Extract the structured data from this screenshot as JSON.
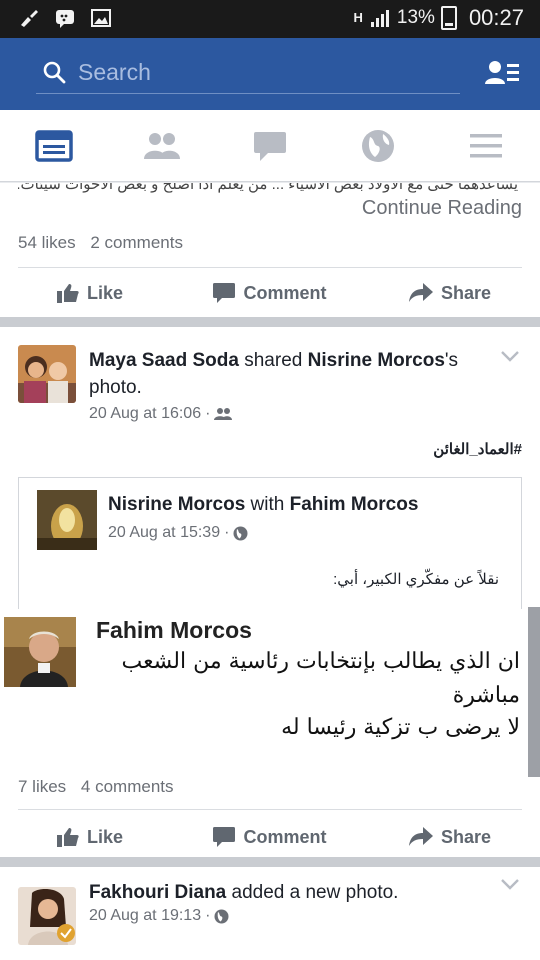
{
  "status_bar": {
    "network": "H",
    "battery": "13%",
    "time": "00:27"
  },
  "search": {
    "placeholder": "Search"
  },
  "tabs": [
    "news-feed",
    "friends",
    "messages",
    "notifications",
    "menu"
  ],
  "post1": {
    "truncated_text": "يساعدهما حتى مع الاولاد بعض الاشياء ... من يعلم اذا اصلح و بعض الاخوات سيئات...",
    "continue_label": "Continue Reading",
    "likes": "54 likes",
    "comments": "2 comments"
  },
  "actions": {
    "like": "Like",
    "comment": "Comment",
    "share": "Share"
  },
  "post2": {
    "author": "Maya Saad Soda",
    "verb": "shared",
    "target": "Nisrine Morcos",
    "target_suffix": "'s photo.",
    "timestamp": "20 Aug at 16:06",
    "hashtag": "#العماد_الغائن",
    "shared": {
      "author": "Nisrine Morcos",
      "with": "with",
      "tagged": "Fahim Morcos",
      "timestamp": "20 Aug at 15:39",
      "text": "نقلاً عن مفكّري الكبير، أبي:"
    },
    "image_quote": {
      "name": "Fahim Morcos",
      "line1": "ان الذي يطالب بإنتخابات رئاسية من الشعب",
      "line2": "مباشرة",
      "line3": "لا يرضى ب تزكية رئيسا له"
    },
    "likes": "7 likes",
    "comments": "4 comments"
  },
  "post3": {
    "author": "Fakhouri Diana",
    "verb": "added a new photo.",
    "timestamp": "20 Aug at 19:13"
  },
  "colors": {
    "brand": "#2c58a0",
    "active_tab": "#2c58a0",
    "inactive_tab": "#b8bcc4"
  }
}
